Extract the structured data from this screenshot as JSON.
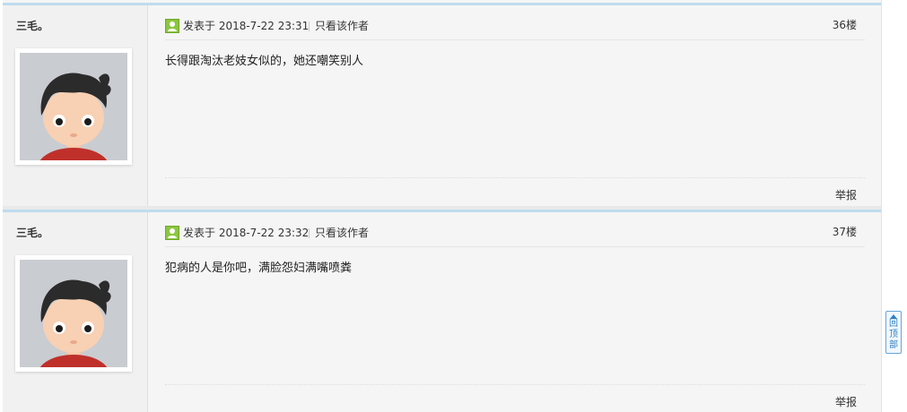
{
  "posts": [
    {
      "author": "三毛。",
      "avatar_icon": "cartoon-boy-avatar",
      "post_time": "发表于 2018-7-22 23:31",
      "only_author": "只看该作者",
      "floor": "36楼",
      "content": "长得跟淘汰老妓女似的，她还嘲笑别人",
      "report": "举报"
    },
    {
      "author": "三毛。",
      "avatar_icon": "cartoon-boy-avatar",
      "post_time": "发表于 2018-7-22 23:32",
      "only_author": "只看该作者",
      "floor": "37楼",
      "content": "犯病的人是你吧，满脸怨妇满嘴喷粪",
      "report": "举报"
    }
  ],
  "back_to_top": {
    "label": "回顶部",
    "icon": "arrow-up-icon"
  },
  "colors": {
    "post_border_top": "#bfdcee",
    "author_col_bg": "#f1f1f1",
    "content_bg": "#f5f5f5",
    "online_icon": "#8cc63f",
    "back_top_border": "#6aa5d6"
  }
}
